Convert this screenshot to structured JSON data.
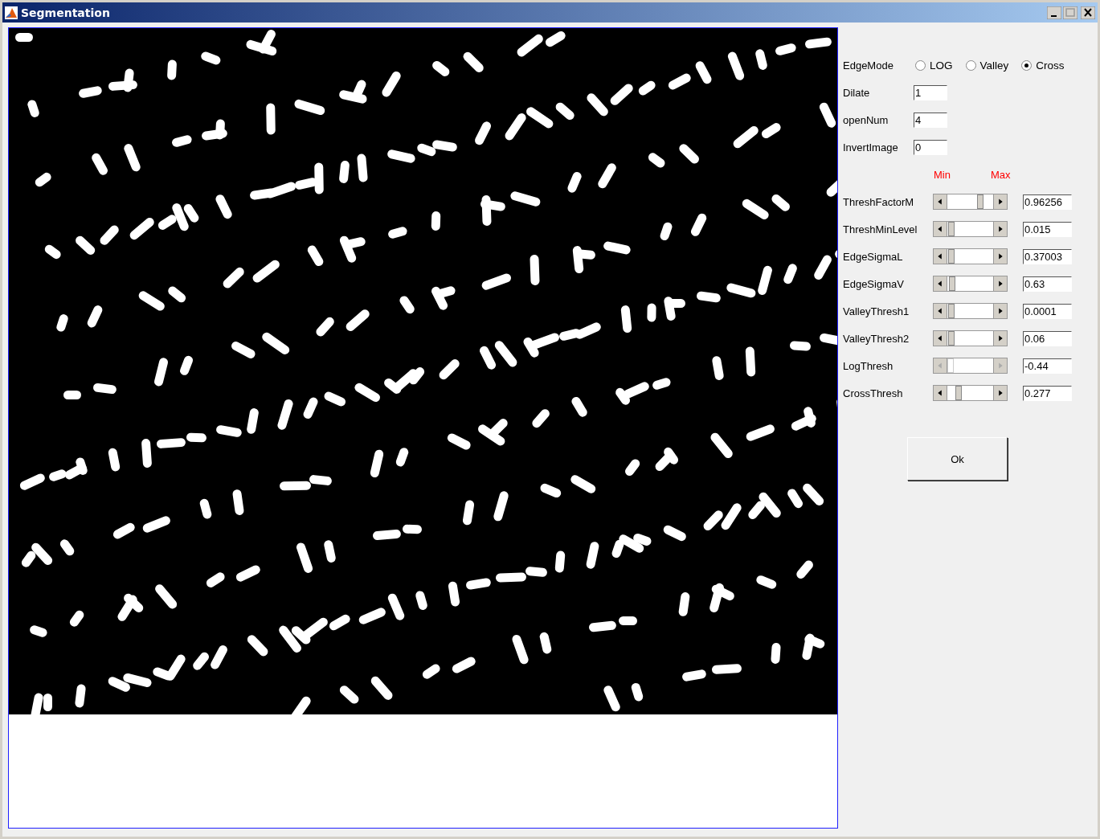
{
  "window": {
    "title": "Segmentation"
  },
  "edge_mode": {
    "label": "EdgeMode",
    "options": [
      {
        "label": "LOG",
        "selected": false
      },
      {
        "label": "Valley",
        "selected": false
      },
      {
        "label": "Cross",
        "selected": true
      }
    ]
  },
  "fields": [
    {
      "label": "Dilate",
      "value": "1"
    },
    {
      "label": "openNum",
      "value": "4"
    },
    {
      "label": "InvertImage",
      "value": "0"
    }
  ],
  "range_labels": {
    "min": "Min",
    "max": "Max"
  },
  "sliders": [
    {
      "label": "ThreshFactorM",
      "level": 0.75,
      "value": "0.96256",
      "disabled": false
    },
    {
      "label": "ThreshMinLevel",
      "level": 0.03,
      "value": "0.015",
      "disabled": false
    },
    {
      "label": "EdgeSigmaL",
      "level": 0.03,
      "value": "0.37003",
      "disabled": false
    },
    {
      "label": "EdgeSigmaV",
      "level": 0.05,
      "value": "0.63",
      "disabled": false
    },
    {
      "label": "ValleyThresh1",
      "level": 0.03,
      "value": "0.0001",
      "disabled": false
    },
    {
      "label": "ValleyThresh2",
      "level": 0.03,
      "value": "0.06",
      "disabled": false
    },
    {
      "label": "LogThresh",
      "level": 0,
      "value": "-0.44",
      "disabled": true
    },
    {
      "label": "CrossThresh",
      "level": 0.2,
      "value": "0.277",
      "disabled": false
    }
  ],
  "ok_button": "Ok"
}
